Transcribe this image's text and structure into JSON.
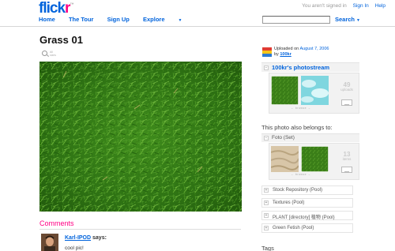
{
  "header": {
    "logo_part1": "flick",
    "logo_part2": "r",
    "logo_beta": "™",
    "signed_status": "You aren't signed in",
    "sign_in": "Sign In",
    "help": "Help",
    "nav": [
      "Home",
      "The Tour",
      "Sign Up",
      "Explore"
    ],
    "search_value": "",
    "search_button": "Search"
  },
  "photo": {
    "title": "Grass 01",
    "tool_label": "All sizes"
  },
  "comments": {
    "heading": "Comments",
    "items": [
      {
        "author": "Karl-IPOD",
        "says": "says:",
        "text": "cool pic!"
      }
    ]
  },
  "sidebar": {
    "uploaded_prefix": "Uploaded on",
    "uploaded_date": "August 7, 2006",
    "by_prefix": "by",
    "uploader": "100kr",
    "photostream_title": "100kr's photostream",
    "photostream_count": "49",
    "photostream_unit": "uploads",
    "nav_text": "← browse →",
    "belongs_heading": "This photo also belongs to:",
    "set_title": "Foto (Set)",
    "set_count": "13",
    "set_unit": "items",
    "pools": [
      "Stock Repository (Pool)",
      "Textures (Pool)",
      "PLANT [directory] 植物 (Pool)",
      "Green Fetish (Pool)"
    ],
    "tags_heading": "Tags"
  },
  "colors": {
    "flickr_blue": "#0063dc",
    "flickr_pink": "#ff0084"
  }
}
